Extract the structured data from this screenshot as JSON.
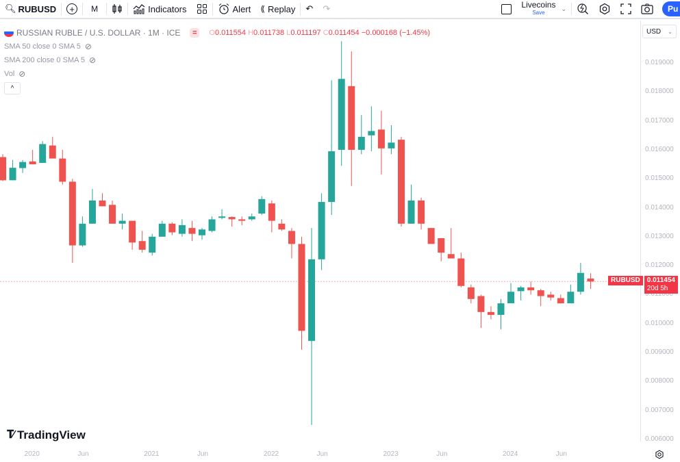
{
  "toolbar": {
    "symbol": "RUBUSD",
    "interval": "M",
    "indicators_label": "Indicators",
    "alert_label": "Alert",
    "replay_label": "Replay",
    "layout_name": "Livecoins",
    "layout_status": "Save",
    "publish_label": "Pu",
    "icons": {
      "search": "search-icon",
      "add_symbol": "plus-circle-icon",
      "chart_type": "candles-icon",
      "indicators": "indicators-icon",
      "templates": "grid-icon",
      "alert": "alarm-icon",
      "replay": "rewind-icon",
      "undo": "undo-icon",
      "redo": "redo-icon",
      "layout": "square-icon",
      "quick_search": "lightning-search-icon",
      "settings": "gear-icon",
      "fullscreen": "fullscreen-icon",
      "snapshot": "camera-icon"
    }
  },
  "legend": {
    "title": "RUSSIAN RUBLE / U.S. DOLLAR · 1M · ICE",
    "ohlc": {
      "o_label": "O",
      "o": "0.011554",
      "h_label": "H",
      "h": "0.011738",
      "l_label": "L",
      "l": "0.011197",
      "c_label": "C",
      "c": "0.011454",
      "change": "−0.000168 (−1.45%)"
    },
    "indicators": [
      {
        "label": "SMA 50 close 0 SMA 5"
      },
      {
        "label": "SMA 200 close 0 SMA 5"
      },
      {
        "label": "Vol"
      }
    ],
    "collapse_symbol": "^"
  },
  "currency_selector": "USD",
  "price_tag": {
    "symbol": "RUBUSD",
    "price": "0.011454",
    "countdown": "20d 5h"
  },
  "brand": "TradingView",
  "colors": {
    "up": "#26a69a",
    "down": "#ef5350",
    "accent": "#2962ff",
    "axis_text": "#b2b5be"
  },
  "chart_data": {
    "type": "candlestick",
    "title": "RUSSIAN RUBLE / U.S. DOLLAR · 1M · ICE",
    "interval": "1M",
    "ylim": [
      0.006,
      0.0195
    ],
    "y_ticks": [
      "0.019000",
      "0.018000",
      "0.017000",
      "0.016000",
      "0.015000",
      "0.014000",
      "0.013000",
      "0.012000",
      "0.011000",
      "0.010000",
      "0.009000",
      "0.008000",
      "0.007000",
      "0.006000"
    ],
    "x_ticks": [
      "2020",
      "Jun",
      "2021",
      "Jun",
      "2022",
      "Jun",
      "2023",
      "Jun",
      "2024",
      "Jun"
    ],
    "last_price": 0.011454,
    "grid": false,
    "candles": [
      {
        "o": 0.01575,
        "h": 0.01585,
        "l": 0.01492,
        "c": 0.01495
      },
      {
        "o": 0.01495,
        "h": 0.01565,
        "l": 0.01495,
        "c": 0.01538
      },
      {
        "o": 0.01537,
        "h": 0.01565,
        "l": 0.0152,
        "c": 0.01558
      },
      {
        "o": 0.0156,
        "h": 0.016,
        "l": 0.01555,
        "c": 0.0155
      },
      {
        "o": 0.01555,
        "h": 0.0163,
        "l": 0.01555,
        "c": 0.0162
      },
      {
        "o": 0.01615,
        "h": 0.01645,
        "l": 0.016,
        "c": 0.0157
      },
      {
        "o": 0.0157,
        "h": 0.016,
        "l": 0.0148,
        "c": 0.0149
      },
      {
        "o": 0.0149,
        "h": 0.015,
        "l": 0.0121,
        "c": 0.0127
      },
      {
        "o": 0.0127,
        "h": 0.0137,
        "l": 0.01265,
        "c": 0.01345
      },
      {
        "o": 0.01345,
        "h": 0.01465,
        "l": 0.01345,
        "c": 0.01425
      },
      {
        "o": 0.01425,
        "h": 0.0145,
        "l": 0.0141,
        "c": 0.01405
      },
      {
        "o": 0.0141,
        "h": 0.01425,
        "l": 0.01345,
        "c": 0.01345
      },
      {
        "o": 0.01345,
        "h": 0.0138,
        "l": 0.01325,
        "c": 0.01355
      },
      {
        "o": 0.01355,
        "h": 0.0135,
        "l": 0.01255,
        "c": 0.0128
      },
      {
        "o": 0.01285,
        "h": 0.0132,
        "l": 0.01245,
        "c": 0.01255
      },
      {
        "o": 0.01245,
        "h": 0.0131,
        "l": 0.01235,
        "c": 0.013
      },
      {
        "o": 0.013,
        "h": 0.01355,
        "l": 0.013,
        "c": 0.01345
      },
      {
        "o": 0.01345,
        "h": 0.0135,
        "l": 0.01305,
        "c": 0.01315
      },
      {
        "o": 0.0131,
        "h": 0.0136,
        "l": 0.013,
        "c": 0.0134
      },
      {
        "o": 0.0133,
        "h": 0.01355,
        "l": 0.01285,
        "c": 0.0131
      },
      {
        "o": 0.01305,
        "h": 0.0133,
        "l": 0.0129,
        "c": 0.01325
      },
      {
        "o": 0.0132,
        "h": 0.0137,
        "l": 0.01315,
        "c": 0.0136
      },
      {
        "o": 0.01365,
        "h": 0.01395,
        "l": 0.0136,
        "c": 0.0137
      },
      {
        "o": 0.01368,
        "h": 0.0137,
        "l": 0.01335,
        "c": 0.0136
      },
      {
        "o": 0.0136,
        "h": 0.0137,
        "l": 0.0134,
        "c": 0.01355
      },
      {
        "o": 0.0136,
        "h": 0.0138,
        "l": 0.01355,
        "c": 0.0137
      },
      {
        "o": 0.0138,
        "h": 0.0144,
        "l": 0.01375,
        "c": 0.0143
      },
      {
        "o": 0.01415,
        "h": 0.01425,
        "l": 0.01315,
        "c": 0.01355
      },
      {
        "o": 0.01345,
        "h": 0.0136,
        "l": 0.0132,
        "c": 0.01325
      },
      {
        "o": 0.0132,
        "h": 0.0133,
        "l": 0.01225,
        "c": 0.01275
      },
      {
        "o": 0.01275,
        "h": 0.013,
        "l": 0.0091,
        "c": 0.00975
      },
      {
        "o": 0.0094,
        "h": 0.0133,
        "l": 0.0065,
        "c": 0.01222
      },
      {
        "o": 0.01222,
        "h": 0.0145,
        "l": 0.01185,
        "c": 0.0142
      },
      {
        "o": 0.0142,
        "h": 0.0184,
        "l": 0.01375,
        "c": 0.01595
      },
      {
        "o": 0.016,
        "h": 0.01975,
        "l": 0.01545,
        "c": 0.01845
      },
      {
        "o": 0.0182,
        "h": 0.0194,
        "l": 0.01475,
        "c": 0.016
      },
      {
        "o": 0.016,
        "h": 0.0172,
        "l": 0.01585,
        "c": 0.01645
      },
      {
        "o": 0.0165,
        "h": 0.0175,
        "l": 0.01595,
        "c": 0.01665
      },
      {
        "o": 0.0167,
        "h": 0.01735,
        "l": 0.01515,
        "c": 0.01605
      },
      {
        "o": 0.01605,
        "h": 0.01685,
        "l": 0.01585,
        "c": 0.01625
      },
      {
        "o": 0.01635,
        "h": 0.01645,
        "l": 0.01335,
        "c": 0.01345
      },
      {
        "o": 0.01345,
        "h": 0.0148,
        "l": 0.01345,
        "c": 0.01425
      },
      {
        "o": 0.01425,
        "h": 0.01435,
        "l": 0.01325,
        "c": 0.01345
      },
      {
        "o": 0.0133,
        "h": 0.0133,
        "l": 0.0128,
        "c": 0.01275
      },
      {
        "o": 0.01295,
        "h": 0.01295,
        "l": 0.01215,
        "c": 0.01245
      },
      {
        "o": 0.0124,
        "h": 0.0133,
        "l": 0.01225,
        "c": 0.01225
      },
      {
        "o": 0.01225,
        "h": 0.01245,
        "l": 0.01125,
        "c": 0.0113
      },
      {
        "o": 0.01125,
        "h": 0.01135,
        "l": 0.0107,
        "c": 0.01085
      },
      {
        "o": 0.01095,
        "h": 0.011,
        "l": 0.00985,
        "c": 0.0104
      },
      {
        "o": 0.0104,
        "h": 0.0106,
        "l": 0.01015,
        "c": 0.0103
      },
      {
        "o": 0.0103,
        "h": 0.01085,
        "l": 0.0098,
        "c": 0.0107
      },
      {
        "o": 0.0107,
        "h": 0.0114,
        "l": 0.0107,
        "c": 0.0111
      },
      {
        "o": 0.01112,
        "h": 0.0113,
        "l": 0.0108,
        "c": 0.01125
      },
      {
        "o": 0.01125,
        "h": 0.01145,
        "l": 0.011,
        "c": 0.01115
      },
      {
        "o": 0.01115,
        "h": 0.0112,
        "l": 0.0106,
        "c": 0.01095
      },
      {
        "o": 0.011,
        "h": 0.0111,
        "l": 0.0108,
        "c": 0.0109
      },
      {
        "o": 0.01088,
        "h": 0.011,
        "l": 0.0107,
        "c": 0.0107
      },
      {
        "o": 0.0107,
        "h": 0.01135,
        "l": 0.0107,
        "c": 0.0111
      },
      {
        "o": 0.0111,
        "h": 0.0121,
        "l": 0.011,
        "c": 0.01175
      },
      {
        "o": 0.011554,
        "h": 0.011738,
        "l": 0.011197,
        "c": 0.011454
      }
    ]
  }
}
